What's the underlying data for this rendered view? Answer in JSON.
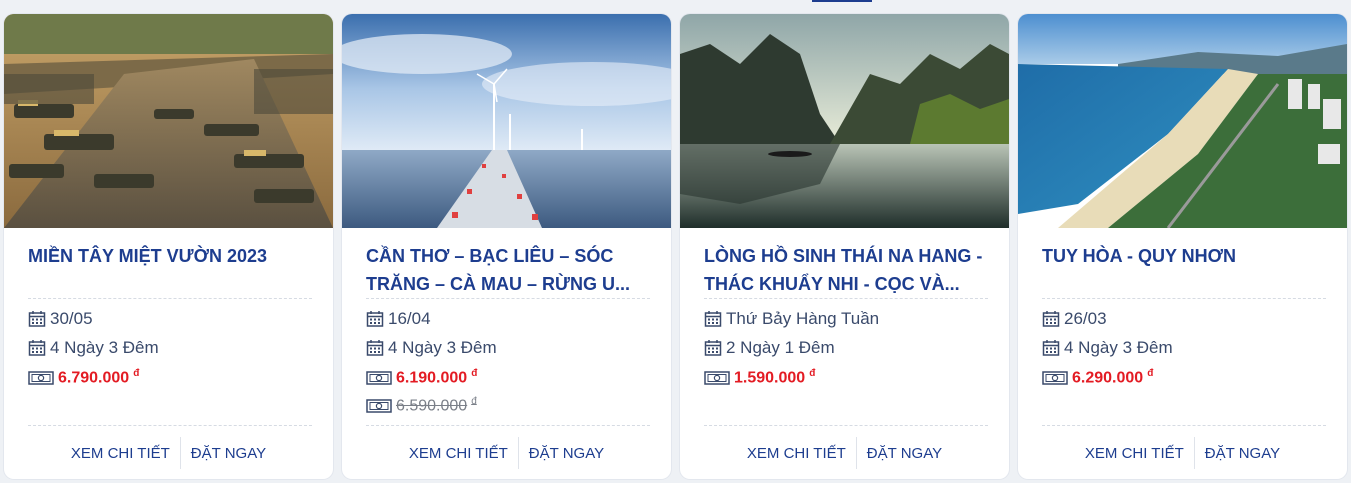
{
  "colors": {
    "accent": "#1d3d8f",
    "price": "#e31b23",
    "old_price": "#7a7f88"
  },
  "icons": {
    "date": "calendar-icon",
    "price": "money-icon"
  },
  "tours": [
    {
      "title": "MIỀN TÂY MIỆT VƯỜN 2023",
      "date": "30/05",
      "duration": "4 Ngày 3 Đêm",
      "price": "6.790.000",
      "currency": "đ",
      "old_price": "",
      "image": "floating-market"
    },
    {
      "title": "CẦN THƠ – BẠC LIÊU – SÓC TRĂNG – CÀ MAU – RỪNG U MINH HẠ",
      "title_display": "CẦN THƠ – BẠC LIÊU – SÓC TRĂNG – CÀ MAU – RỪNG U...",
      "date": "16/04",
      "duration": "4 Ngày 3 Đêm",
      "price": "6.190.000",
      "currency": "đ",
      "old_price": "6.590.000",
      "image": "wind-farm"
    },
    {
      "title": "LÒNG HỒ SINH THÁI NA HANG - THÁC KHUẨY NHI - CỌC VÀ...",
      "date": "Thứ Bảy Hàng Tuần",
      "duration": "2 Ngày 1 Đêm",
      "price": "1.590.000",
      "currency": "đ",
      "old_price": "",
      "image": "lake-mountains"
    },
    {
      "title": "TUY HÒA - QUY NHƠN",
      "date": "26/03",
      "duration": "4 Ngày 3 Đêm",
      "price": "6.290.000",
      "currency": "đ",
      "old_price": "",
      "image": "beach-city"
    }
  ],
  "actions": {
    "detail": "XEM CHI TIẾT",
    "book": "ĐẶT NGAY"
  }
}
